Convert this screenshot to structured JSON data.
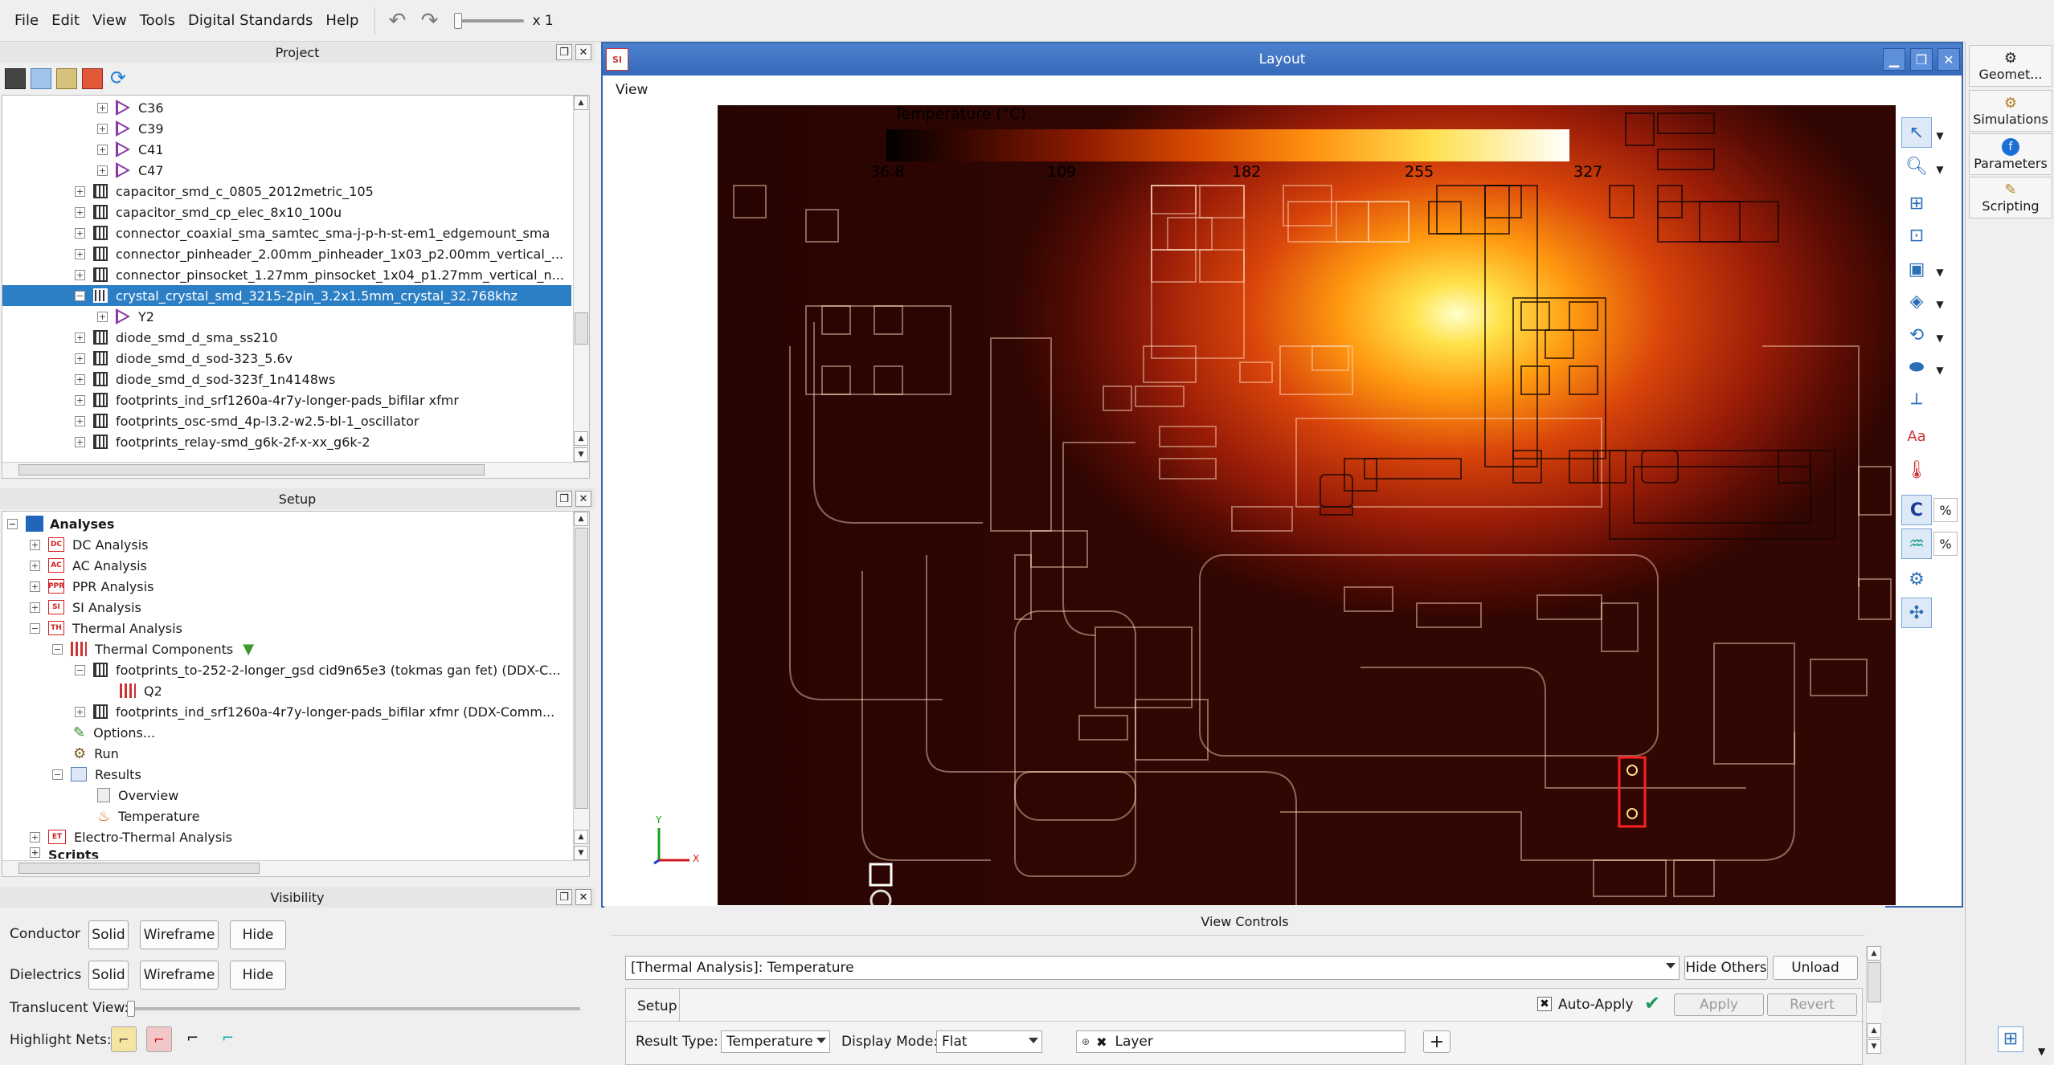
{
  "menu": [
    "File",
    "Edit",
    "View",
    "Tools",
    "Digital Standards",
    "Help"
  ],
  "zoom_label": "x 1",
  "project": {
    "title": "Project",
    "items": [
      {
        "label": "C36",
        "type": "cap"
      },
      {
        "label": "C39",
        "type": "cap"
      },
      {
        "label": "C41",
        "type": "cap"
      },
      {
        "label": "C47",
        "type": "cap"
      },
      {
        "label": "capacitor_smd_c_0805_2012metric_105",
        "type": "comp"
      },
      {
        "label": "capacitor_smd_cp_elec_8x10_100u",
        "type": "comp"
      },
      {
        "label": "connector_coaxial_sma_samtec_sma-j-p-h-st-em1_edgemount_sma",
        "type": "comp"
      },
      {
        "label": "connector_pinheader_2.00mm_pinheader_1x03_p2.00mm_vertical_...",
        "type": "comp"
      },
      {
        "label": "connector_pinsocket_1.27mm_pinsocket_1x04_p1.27mm_vertical_n...",
        "type": "comp"
      },
      {
        "label": "crystal_crystal_smd_3215-2pin_3.2x1.5mm_crystal_32.768khz",
        "type": "comp",
        "selected": true
      },
      {
        "label": "Y2",
        "type": "cap"
      },
      {
        "label": "diode_smd_d_sma_ss210",
        "type": "comp"
      },
      {
        "label": "diode_smd_d_sod-323_5.6v",
        "type": "comp"
      },
      {
        "label": "diode_smd_d_sod-323f_1n4148ws",
        "type": "comp"
      },
      {
        "label": "footprints_ind_srf1260a-4r7y-longer-pads_bifilar xfmr",
        "type": "comp"
      },
      {
        "label": "footprints_osc-smd_4p-l3.2-w2.5-bl-1_oscillator",
        "type": "comp"
      },
      {
        "label": "footprints_relay-smd_g6k-2f-x-xx_g6k-2",
        "type": "comp"
      }
    ]
  },
  "setup": {
    "title": "Setup",
    "analyses": "Analyses",
    "items": [
      {
        "label": "DC Analysis",
        "icon": "DC"
      },
      {
        "label": "AC Analysis",
        "icon": "AC"
      },
      {
        "label": "PPR Analysis",
        "icon": "PPR"
      },
      {
        "label": "SI Analysis",
        "icon": "SI"
      },
      {
        "label": "Thermal Analysis",
        "icon": "TH"
      }
    ],
    "thermal_components": "Thermal Components",
    "comp1": "footprints_to-252-2-longer_gsd cid9n65e3 (tokmas gan fet) (DDX-C...",
    "q2": "Q2",
    "comp2": "footprints_ind_srf1260a-4r7y-longer-pads_bifilar xfmr (DDX-Comm...",
    "options": "Options...",
    "run": "Run",
    "results": "Results",
    "overview": "Overview",
    "temperature": "Temperature",
    "electro": "Electro-Thermal Analysis",
    "scripts": "Scripts"
  },
  "visibility": {
    "title": "Visibility",
    "conductor": "Conductor",
    "dielectrics": "Dielectrics",
    "solid": "Solid",
    "wireframe": "Wireframe",
    "hide": "Hide",
    "translucent": "Translucent View:",
    "highlight": "Highlight Nets:"
  },
  "layout": {
    "title": "Layout",
    "view_menu": "View",
    "legend_title": "Temperature (°C)",
    "ticks": [
      "36.8",
      "109",
      "182",
      "255",
      "327"
    ],
    "colors": {
      "accent": "#3569b9",
      "selection": "#2d7fc5"
    }
  },
  "view_controls": {
    "title": "View Controls",
    "selected": "[Thermal Analysis]: Temperature",
    "hide_others": "Hide Others",
    "unload": "Unload",
    "setup_tab": "Setup",
    "auto_apply": "Auto-Apply",
    "apply": "Apply",
    "revert": "Revert",
    "result_type_label": "Result Type:",
    "result_type": "Temperature",
    "display_mode_label": "Display Mode:",
    "display_mode": "Flat",
    "layer": "Layer"
  },
  "right_tabs": [
    "Geomet...",
    "Simulations",
    "Parameters",
    "Scripting"
  ]
}
